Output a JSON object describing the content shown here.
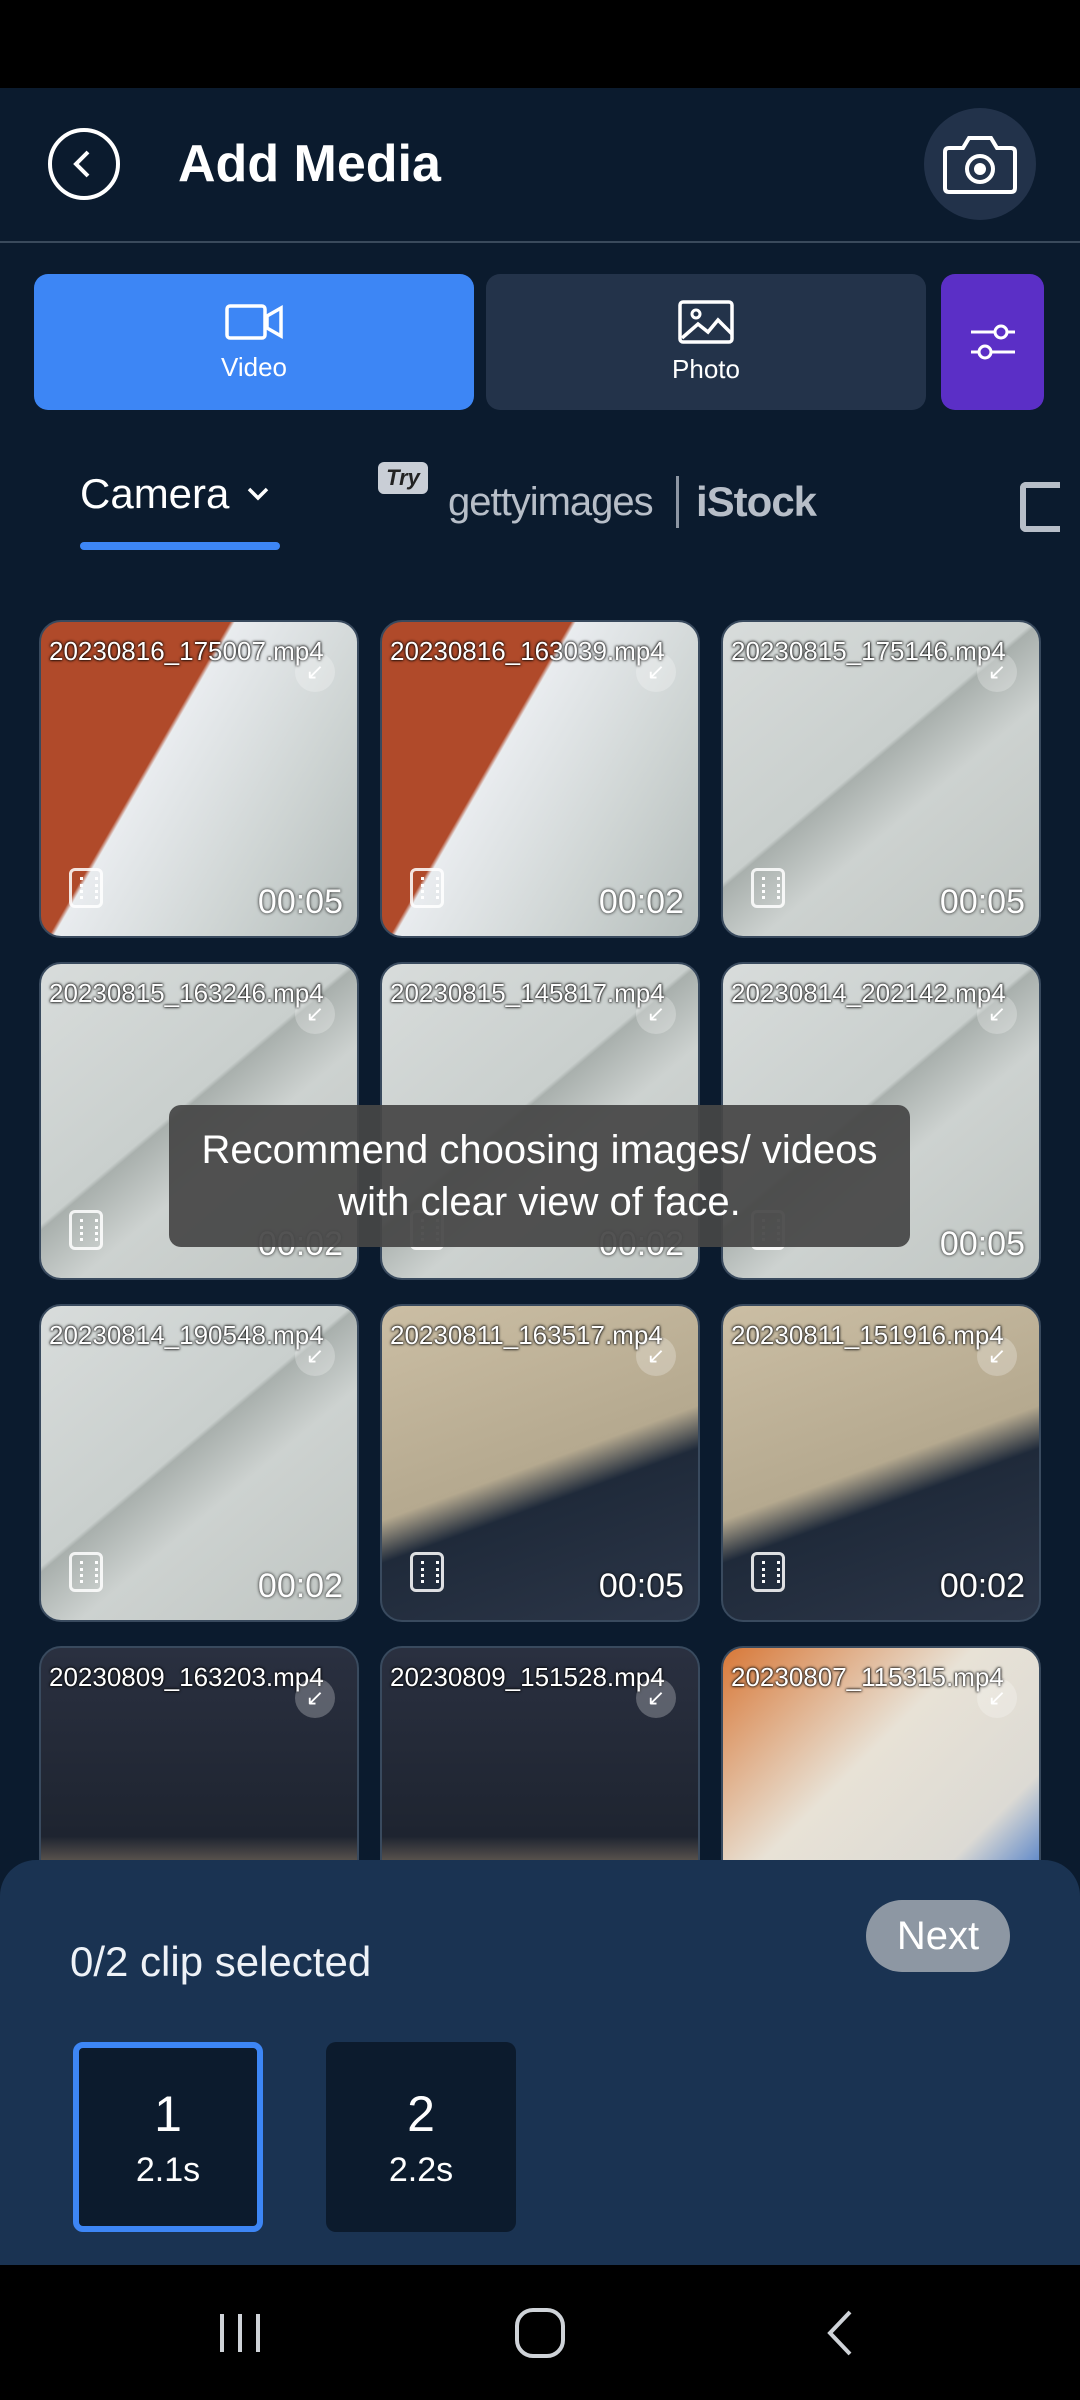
{
  "header": {
    "title": "Add Media"
  },
  "type_tabs": {
    "video": "Video",
    "photo": "Photo"
  },
  "sources": {
    "camera": "Camera",
    "try_badge": "Try",
    "getty": "gettyimages",
    "istock": "iStock"
  },
  "media": [
    {
      "name": "20230816_175007.mp4",
      "duration": "00:05",
      "thumb": "tea"
    },
    {
      "name": "20230816_163039.mp4",
      "duration": "00:02",
      "thumb": "tea"
    },
    {
      "name": "20230815_175146.mp4",
      "duration": "00:05",
      "thumb": "wall"
    },
    {
      "name": "20230815_163246.mp4",
      "duration": "00:02",
      "thumb": "wall"
    },
    {
      "name": "20230815_145817.mp4",
      "duration": "00:02",
      "thumb": "wall"
    },
    {
      "name": "20230814_202142.mp4",
      "duration": "00:05",
      "thumb": "wall"
    },
    {
      "name": "20230814_190548.mp4",
      "duration": "00:02",
      "thumb": "wall"
    },
    {
      "name": "20230811_163517.mp4",
      "duration": "00:05",
      "thumb": "beige"
    },
    {
      "name": "20230811_151916.mp4",
      "duration": "00:02",
      "thumb": "beige"
    },
    {
      "name": "20230809_163203.mp4",
      "duration": "",
      "thumb": "dark"
    },
    {
      "name": "20230809_151528.mp4",
      "duration": "",
      "thumb": "dark"
    },
    {
      "name": "20230807_115315.mp4",
      "duration": "",
      "thumb": "orange"
    }
  ],
  "toast": "Recommend choosing images/ videos with clear view of face.",
  "selection": {
    "count_text": "0/2 clip selected",
    "next_label": "Next",
    "slots": [
      {
        "number": "1",
        "length": "2.1s",
        "active": true
      },
      {
        "number": "2",
        "length": "2.2s",
        "active": false
      }
    ]
  },
  "colors": {
    "accent": "#3d86f5",
    "filter": "#5b2fc6",
    "background": "#0b1b2e",
    "panel": "#1a3352"
  }
}
